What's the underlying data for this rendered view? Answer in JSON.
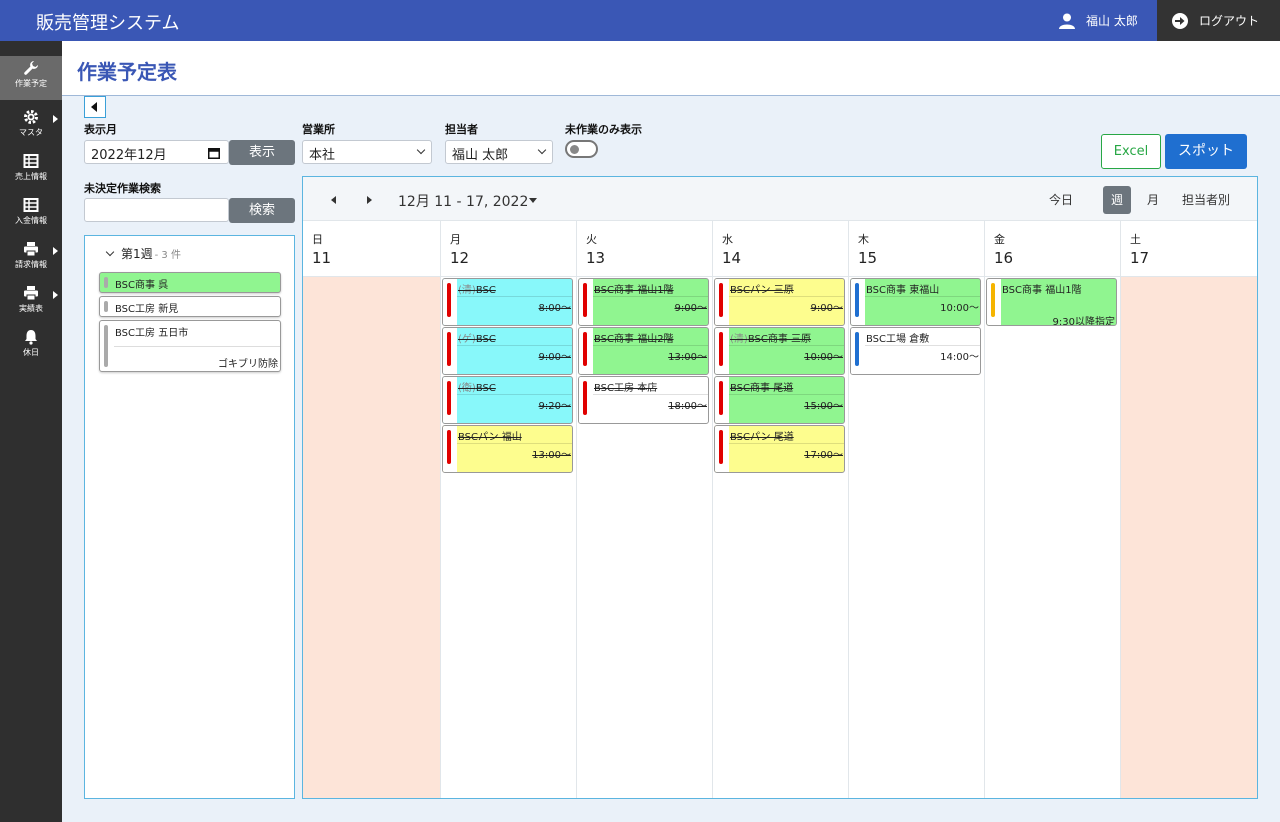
{
  "app": {
    "title": "販売管理システム",
    "user": "福山 太郎",
    "logout": "ログアウト"
  },
  "sidebar": {
    "items": [
      {
        "label": "作業予定"
      },
      {
        "label": "マスタ"
      },
      {
        "label": "売上情報"
      },
      {
        "label": "入金情報"
      },
      {
        "label": "請求情報"
      },
      {
        "label": "実績表"
      },
      {
        "label": "休日"
      }
    ]
  },
  "page": {
    "title": "作業予定表"
  },
  "filters": {
    "month_label": "表示月",
    "month_value": "2022年12月",
    "show_button": "表示",
    "office_label": "営業所",
    "office_value": "本社",
    "staff_label": "担当者",
    "staff_value": "福山 太郎",
    "unworked_label": "未作業のみ表示",
    "excel_button": "Excel",
    "spot_button": "スポット",
    "search_label": "未決定作業検索",
    "search_button": "検索"
  },
  "pending": {
    "week_title": "第1週",
    "week_count": "- 3 件",
    "tasks": [
      {
        "name": "BSC商事 呉",
        "sub": ""
      },
      {
        "name": "BSC工房 新見",
        "sub": ""
      },
      {
        "name": "BSC工房 五日市",
        "sub": "ゴキブリ防除"
      }
    ]
  },
  "calendar": {
    "range": "12月 11 - 17, 2022",
    "today": "今日",
    "view_week": "週",
    "view_month": "月",
    "view_staff": "担当者別",
    "days": [
      {
        "dow": "日",
        "num": "11",
        "events": []
      },
      {
        "dow": "月",
        "num": "12",
        "events": [
          {
            "mark": "(清)",
            "name": "BSC",
            "time": "8:00～"
          },
          {
            "mark": "(ゲ)",
            "name": "BSC",
            "time": "9:00～"
          },
          {
            "mark": "(衛)",
            "name": "BSC",
            "time": "9:20～"
          },
          {
            "mark": "",
            "name": "BSCパン 福山",
            "time": "13:00～"
          }
        ]
      },
      {
        "dow": "火",
        "num": "13",
        "events": [
          {
            "mark": "",
            "name": "BSC商事 福山1階",
            "time": "9:00～"
          },
          {
            "mark": "",
            "name": "BSC商事 福山2階",
            "time": "13:00～"
          },
          {
            "mark": "",
            "name": "BSC工房 本店",
            "time": "18:00～"
          }
        ]
      },
      {
        "dow": "水",
        "num": "14",
        "events": [
          {
            "mark": "",
            "name": "BSCパン 三原",
            "time": "9:00～"
          },
          {
            "mark": "(清)",
            "name": "BSC商事 三原",
            "time": "10:00～"
          },
          {
            "mark": "",
            "name": "BSC商事 尾道",
            "time": "15:00～"
          },
          {
            "mark": "",
            "name": "BSCパン 尾道",
            "time": "17:00～"
          }
        ]
      },
      {
        "dow": "木",
        "num": "15",
        "events": [
          {
            "mark": "",
            "name": "BSC商事 東福山",
            "time": "10:00～"
          },
          {
            "mark": "",
            "name": "BSC工場 倉敷",
            "time": "14:00～"
          }
        ]
      },
      {
        "dow": "金",
        "num": "16",
        "events": [
          {
            "mark": "",
            "name": "BSC商事 福山1階",
            "time": "9:30以降指定"
          }
        ]
      },
      {
        "dow": "土",
        "num": "17",
        "events": []
      }
    ]
  },
  "colors": {
    "brand": "#3a57b5",
    "cyan": "#88f8fa",
    "yellow": "#fdfd8e",
    "green": "#90f590",
    "red_bar": "#e00000",
    "blue_bar": "#1f6fd0",
    "amber_bar": "#f5b400",
    "weekend": "#fde4d8"
  }
}
